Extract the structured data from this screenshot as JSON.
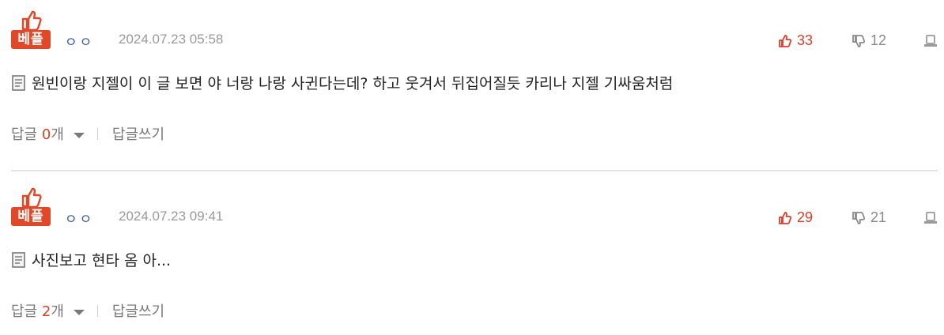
{
  "comments": [
    {
      "badge": "베플",
      "nickname": "ㅇㅇ",
      "date": "2024.07.23 05:58",
      "upvotes": "33",
      "downvotes": "12",
      "text": "원빈이랑 지젤이 이 글 보면 야 너랑 나랑 사귄다는데? 하고 웃겨서 뒤집어질듯 카리나 지젤 기싸움처럼",
      "reply_label": "답글",
      "reply_count": "0",
      "reply_unit": "개",
      "write_reply": "답글쓰기"
    },
    {
      "badge": "베플",
      "nickname": "ㅇㅇ",
      "date": "2024.07.23 09:41",
      "upvotes": "29",
      "downvotes": "21",
      "text": "사진보고 현타 옴 아...",
      "reply_label": "답글",
      "reply_count": "2",
      "reply_unit": "개",
      "write_reply": "답글쓰기"
    }
  ],
  "colors": {
    "accent": "#e0482a",
    "upvote": "#d8402a",
    "downvote": "#8a8a8a",
    "nickname": "#3a5a9a",
    "date": "#9a9a9a"
  },
  "icons": [
    "thumbs-up-icon",
    "thumbs-down-icon",
    "report-icon",
    "document-icon",
    "caret-down-icon"
  ]
}
